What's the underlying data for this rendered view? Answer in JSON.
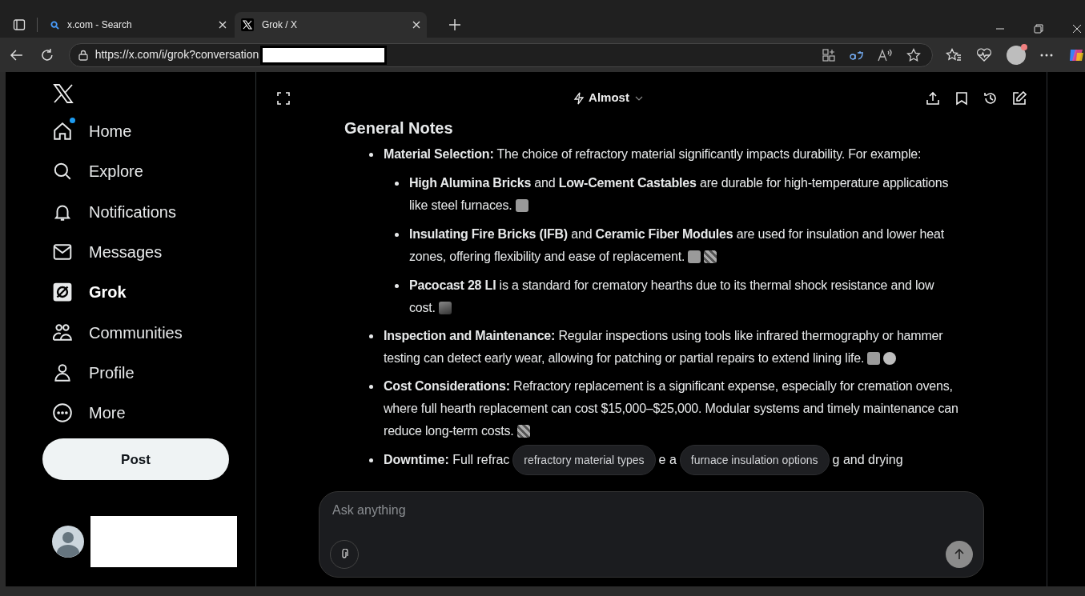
{
  "browser": {
    "tabs": [
      {
        "title": "x.com - Search",
        "selected": false
      },
      {
        "title": "Grok / X",
        "selected": true
      }
    ],
    "url": "https://x.com/i/grok?conversation"
  },
  "sidebar": {
    "items": [
      {
        "label": "Home",
        "selected": false,
        "badge": true
      },
      {
        "label": "Explore",
        "selected": false,
        "badge": false
      },
      {
        "label": "Notifications",
        "selected": false,
        "badge": false
      },
      {
        "label": "Messages",
        "selected": false,
        "badge": false
      },
      {
        "label": "Grok",
        "selected": true,
        "badge": false
      },
      {
        "label": "Communities",
        "selected": false,
        "badge": false
      },
      {
        "label": "Profile",
        "selected": false,
        "badge": false
      },
      {
        "label": "More",
        "selected": false,
        "badge": false
      }
    ],
    "post_button": "Post"
  },
  "header": {
    "model": "Almost"
  },
  "answer": {
    "heading": "General Notes",
    "items": [
      {
        "text": "**Material Selection:** The choice of refractory material significantly impacts durability. For example:",
        "children": [
          {
            "text": "**High Alumina Bricks** and **Low-Cement Castables** are durable for high-temperature applications like steel furnaces.",
            "images": [
              {
                "kind": "tile"
              }
            ]
          },
          {
            "text": "**Insulating Fire Bricks (IFB)** and **Ceramic Fiber Modules** are used for insulation and lower heat zones, offering flexibility and ease of replacement.",
            "images": [
              {
                "kind": "tile"
              },
              {
                "kind": "grid"
              }
            ]
          },
          {
            "text": "**Pacocast 28 LI** is a standard for crematory hearths due to its thermal shock resistance and low cost.",
            "images": [
              {
                "kind": "photo"
              }
            ]
          }
        ]
      },
      {
        "text": "**Inspection and Maintenance:** Regular inspections using tools like infrared thermography or hammer testing can detect early wear, allowing for patching or partial repairs to extend lining life.",
        "images": [
          {
            "kind": "tile"
          },
          {
            "kind": "cube"
          }
        ]
      },
      {
        "text": "**Cost Considerations:** Refractory replacement is a significant expense, especially for cremation ovens, where full hearth replacement can cost $15,000–$25,000. Modular systems and timely maintenance can reduce long-term costs.",
        "images": [
          {
            "kind": "grid"
          }
        ]
      }
    ],
    "partial_line": {
      "fragments": [
        "**Downtime:** Full refrac",
        "e a",
        "g and drying"
      ]
    }
  },
  "suggestions": [
    "refractory material types",
    "furnace insulation options"
  ],
  "composer": {
    "placeholder": "Ask anything"
  }
}
